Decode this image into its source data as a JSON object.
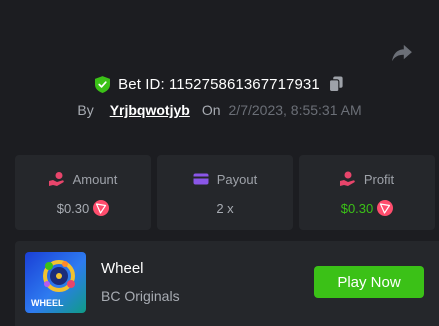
{
  "bet": {
    "id_label": "Bet ID: 115275861367717931",
    "by_label": "By",
    "username": "Yrjbqwotjyb",
    "on_label": "On",
    "datetime": "2/7/2023, 8:55:31 AM"
  },
  "stats": [
    {
      "label": "Amount",
      "value": "$0.30",
      "icon": "money-hand-icon",
      "currency_icon": "tron-coin-icon"
    },
    {
      "label": "Payout",
      "value": "2 x",
      "icon": "wallet-card-icon"
    },
    {
      "label": "Profit",
      "value": "$0.30",
      "icon": "profit-hand-icon",
      "currency_icon": "tron-coin-icon",
      "value_color": "#3bc117"
    }
  ],
  "game": {
    "name": "Wheel",
    "provider": "BC Originals",
    "thumb_text": "WHEEL",
    "play_label": "Play Now"
  },
  "colors": {
    "accent_green": "#3bc117",
    "shield_green": "#3bc117",
    "amount_icon": "#e8456b",
    "payout_icon": "#8a56e8",
    "profit_icon": "#e8456b"
  }
}
